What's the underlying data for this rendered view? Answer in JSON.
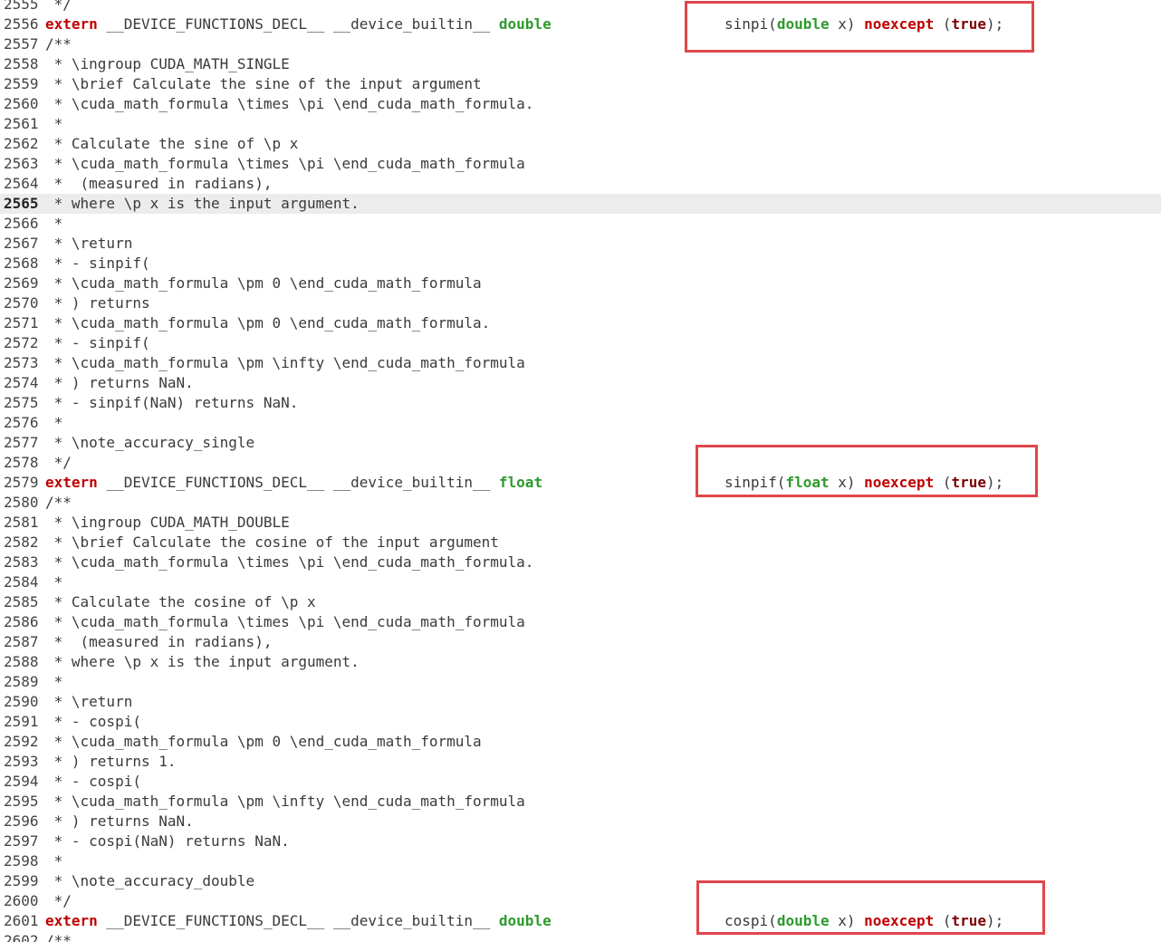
{
  "colors": {
    "keyword": "#c00000",
    "type": "#2e9a2e",
    "literal": "#7a0000",
    "highlight_box": "#e0464c",
    "current_line": "#ececec"
  },
  "current_line": "2565",
  "lines": [
    {
      "n": "2555",
      "kind": "comment",
      "text": " */"
    },
    {
      "n": "2556",
      "kind": "decl",
      "ret": "double",
      "fn": "sinpi",
      "ptype": "double"
    },
    {
      "n": "2557",
      "kind": "comment",
      "text": "/**"
    },
    {
      "n": "2558",
      "kind": "comment",
      "text": " * \\ingroup CUDA_MATH_SINGLE"
    },
    {
      "n": "2559",
      "kind": "comment",
      "text": " * \\brief Calculate the sine of the input argument"
    },
    {
      "n": "2560",
      "kind": "comment",
      "text": " * \\cuda_math_formula \\times \\pi \\end_cuda_math_formula."
    },
    {
      "n": "2561",
      "kind": "comment",
      "text": " *"
    },
    {
      "n": "2562",
      "kind": "comment",
      "text": " * Calculate the sine of \\p x"
    },
    {
      "n": "2563",
      "kind": "comment",
      "text": " * \\cuda_math_formula \\times \\pi \\end_cuda_math_formula"
    },
    {
      "n": "2564",
      "kind": "comment",
      "text": " *  (measured in radians),"
    },
    {
      "n": "2565",
      "kind": "comment",
      "text": " * where \\p x is the input argument."
    },
    {
      "n": "2566",
      "kind": "comment",
      "text": " *"
    },
    {
      "n": "2567",
      "kind": "comment",
      "text": " * \\return"
    },
    {
      "n": "2568",
      "kind": "comment",
      "text": " * - sinpif("
    },
    {
      "n": "2569",
      "kind": "comment",
      "text": " * \\cuda_math_formula \\pm 0 \\end_cuda_math_formula"
    },
    {
      "n": "2570",
      "kind": "comment",
      "text": " * ) returns"
    },
    {
      "n": "2571",
      "kind": "comment",
      "text": " * \\cuda_math_formula \\pm 0 \\end_cuda_math_formula."
    },
    {
      "n": "2572",
      "kind": "comment",
      "text": " * - sinpif("
    },
    {
      "n": "2573",
      "kind": "comment",
      "text": " * \\cuda_math_formula \\pm \\infty \\end_cuda_math_formula"
    },
    {
      "n": "2574",
      "kind": "comment",
      "text": " * ) returns NaN."
    },
    {
      "n": "2575",
      "kind": "comment",
      "text": " * - sinpif(NaN) returns NaN."
    },
    {
      "n": "2576",
      "kind": "comment",
      "text": " *"
    },
    {
      "n": "2577",
      "kind": "comment",
      "text": " * \\note_accuracy_single"
    },
    {
      "n": "2578",
      "kind": "comment",
      "text": " */"
    },
    {
      "n": "2579",
      "kind": "decl",
      "ret": "float",
      "fn": "sinpif",
      "ptype": "float"
    },
    {
      "n": "2580",
      "kind": "comment",
      "text": "/**"
    },
    {
      "n": "2581",
      "kind": "comment",
      "text": " * \\ingroup CUDA_MATH_DOUBLE"
    },
    {
      "n": "2582",
      "kind": "comment",
      "text": " * \\brief Calculate the cosine of the input argument"
    },
    {
      "n": "2583",
      "kind": "comment",
      "text": " * \\cuda_math_formula \\times \\pi \\end_cuda_math_formula."
    },
    {
      "n": "2584",
      "kind": "comment",
      "text": " *"
    },
    {
      "n": "2585",
      "kind": "comment",
      "text": " * Calculate the cosine of \\p x"
    },
    {
      "n": "2586",
      "kind": "comment",
      "text": " * \\cuda_math_formula \\times \\pi \\end_cuda_math_formula"
    },
    {
      "n": "2587",
      "kind": "comment",
      "text": " *  (measured in radians),"
    },
    {
      "n": "2588",
      "kind": "comment",
      "text": " * where \\p x is the input argument."
    },
    {
      "n": "2589",
      "kind": "comment",
      "text": " *"
    },
    {
      "n": "2590",
      "kind": "comment",
      "text": " * \\return"
    },
    {
      "n": "2591",
      "kind": "comment",
      "text": " * - cospi("
    },
    {
      "n": "2592",
      "kind": "comment",
      "text": " * \\cuda_math_formula \\pm 0 \\end_cuda_math_formula"
    },
    {
      "n": "2593",
      "kind": "comment",
      "text": " * ) returns 1."
    },
    {
      "n": "2594",
      "kind": "comment",
      "text": " * - cospi("
    },
    {
      "n": "2595",
      "kind": "comment",
      "text": " * \\cuda_math_formula \\pm \\infty \\end_cuda_math_formula"
    },
    {
      "n": "2596",
      "kind": "comment",
      "text": " * ) returns NaN."
    },
    {
      "n": "2597",
      "kind": "comment",
      "text": " * - cospi(NaN) returns NaN."
    },
    {
      "n": "2598",
      "kind": "comment",
      "text": " *"
    },
    {
      "n": "2599",
      "kind": "comment",
      "text": " * \\note_accuracy_double"
    },
    {
      "n": "2600",
      "kind": "comment",
      "text": " */"
    },
    {
      "n": "2601",
      "kind": "decl",
      "ret": "double",
      "fn": "cospi",
      "ptype": "double"
    },
    {
      "n": "2602",
      "kind": "comment",
      "text": "/**"
    }
  ],
  "decl_tokens": {
    "extern": "extern",
    "macro": " __DEVICE_FUNCTIONS_DECL__ __device_builtin__ ",
    "open_paren": "(",
    "param": " x) ",
    "noexcept": "noexcept",
    "space_paren": " (",
    "true": "true",
    "end": ");"
  },
  "highlights": [
    "2556",
    "2579",
    "2601"
  ]
}
